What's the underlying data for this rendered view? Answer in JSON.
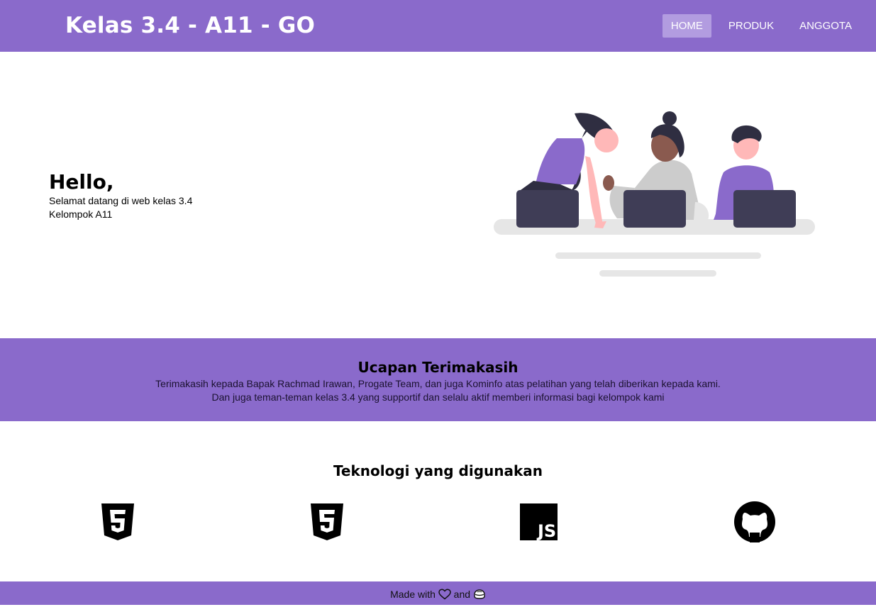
{
  "header": {
    "brand": "Kelas 3.4 - A11 - GO",
    "nav": [
      {
        "label": "HOME",
        "active": true
      },
      {
        "label": "PRODUK",
        "active": false
      },
      {
        "label": "ANGGOTA",
        "active": false
      }
    ]
  },
  "hero": {
    "title": "Hello,",
    "line1": "Selamat datang di web kelas 3.4",
    "line2": "Kelompok A11"
  },
  "thanks": {
    "title": "Ucapan Terimakasih",
    "line1": "Terimakasih kepada Bapak Rachmad Irawan, Progate Team, dan juga Kominfo atas pelatihan yang telah diberikan kepada kami.",
    "line2": "Dan juga teman-teman kelas 3.4 yang supportif dan selalu aktif memberi informasi bagi kelompok kami"
  },
  "tech": {
    "title": "Teknologi yang digunakan",
    "icons": [
      "html5-icon",
      "css3-icon",
      "javascript-icon",
      "github-icon"
    ],
    "js_text": "JS"
  },
  "footer": {
    "made_with": "Made with",
    "and": "and"
  },
  "colors": {
    "primary": "#8a6acb",
    "nav_active": "#b29ce0",
    "laptop": "#3f3d56"
  }
}
